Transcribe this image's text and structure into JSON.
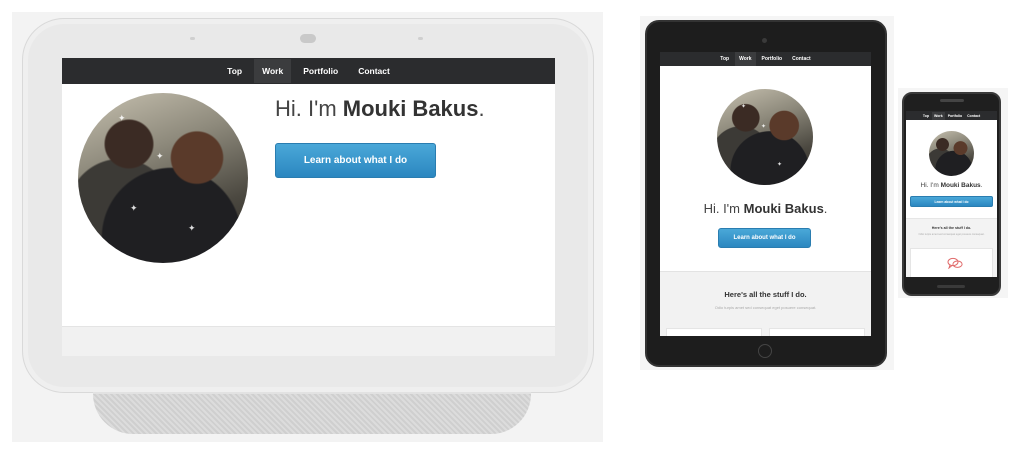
{
  "nav": {
    "items": [
      {
        "label": "Top",
        "active": false
      },
      {
        "label": "Work",
        "active": true
      },
      {
        "label": "Portfolio",
        "active": false
      },
      {
        "label": "Contact",
        "active": false
      }
    ]
  },
  "hero": {
    "greeting": "Hi. I'm ",
    "name": "Mouki Bakus",
    "period": ".",
    "cta_label": "Learn about what I do"
  },
  "work": {
    "heading": "Here's all the stuff I do.",
    "subheading": "Odio turpis amet sed consequat eget posuere consequat.",
    "phone_subheading": "Odio turpis amet sed consequat eget posuere consequat."
  },
  "colors": {
    "nav_bg": "#2b2c2e",
    "cta_blue": "#3a98cc",
    "device_dark": "#1d1d1d",
    "device_light": "#e9e9e9",
    "chat_icon": "#e06b6b"
  },
  "icons": {
    "chat": "chat-bubbles-icon",
    "camera": "camera-icon",
    "home": "home-button-icon"
  }
}
